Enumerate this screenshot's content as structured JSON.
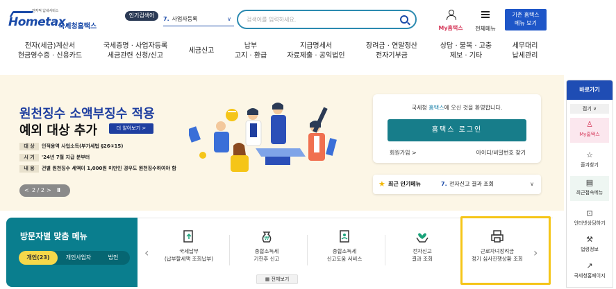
{
  "header": {
    "logo_tagline": "전자적 납세서비스",
    "logo_main": "Hometax.",
    "logo_sub": "국세청홈택스",
    "popular_badge": "인기검색어",
    "popular_item": {
      "num": "7.",
      "text": "사업자등록",
      "caret": "∨"
    },
    "search_placeholder": "검색어를 입력하세요.",
    "my_hometax": "My홈택스",
    "all_menu": "전체메뉴",
    "old_home": "기존 홈택스\n메뉴 보기"
  },
  "gnb": [
    {
      "line1": "전자(세금)계산서",
      "line2": "현금영수증 · 신용카드"
    },
    {
      "line1": "국세증명 · 사업자등록",
      "line2": "세금관련 신청/신고"
    },
    {
      "line1": "세금신고",
      "line2": ""
    },
    {
      "line1": "납부",
      "line2": "고지 · 환급"
    },
    {
      "line1": "지급명세서",
      "line2": "자료제출 · 공익법인"
    },
    {
      "line1": "장려금 · 연말정산",
      "line2": "전자기부금"
    },
    {
      "line1": "상담 · 불복 · 고충",
      "line2": "제보 · 기타"
    },
    {
      "line1": "세무대리",
      "line2": "납세관리"
    }
  ],
  "banner": {
    "title1": "원천징수 소액부징수 적용",
    "title2": "예외 대상 추가",
    "more": "더 알아보기 >",
    "rows": [
      {
        "key": "대 상",
        "value": "인적용역 사업소득(부가세법 §26①15)"
      },
      {
        "key": "시 기",
        "value": "'24년 7월 지급 분부터"
      },
      {
        "key": "내 용",
        "value": "건별 원천징수 세액이 1,000원 미만인 경우도 원천징수하여야 함"
      }
    ],
    "pager": {
      "prev": "<",
      "count": "2 / 2",
      "next": ">",
      "pause": "II"
    }
  },
  "login": {
    "welcome_pre": "국세청 ",
    "welcome_brand": "홈택스",
    "welcome_post": "에 오신 것을 환영합니다.",
    "login_button": "홈택스 로그인",
    "join": "회원가입 >",
    "find": "아이디/비밀번호 찾기"
  },
  "popular_menu": {
    "title": "최근 인기메뉴",
    "num": "7.",
    "text": "전자신고 결과 조회",
    "caret": "∨"
  },
  "visitor": {
    "title": "방문자별 맞춤 메뉴",
    "tabs": [
      "개인(23)",
      "개인사업자",
      "법인"
    ],
    "active_tab": 0
  },
  "services": {
    "prev": "‹",
    "next": "›",
    "items": [
      {
        "line1": "국세납부",
        "line2": "(납부할세액 조회납부)",
        "icon": "bill-upload-icon"
      },
      {
        "line1": "종합소득세",
        "line2": "기한후 신고",
        "icon": "money-bag-icon"
      },
      {
        "line1": "종합소득세",
        "line2": "신고도움 서비스",
        "icon": "document-person-icon"
      },
      {
        "line1": "전자신고",
        "line2": "결과 조회",
        "icon": "heart-hands-icon"
      },
      {
        "line1": "근로자녀장려금",
        "line2": "정기 심사진행상황 조회",
        "icon": "printer-icon"
      }
    ],
    "view_all": "전체보기"
  },
  "quick_menu": {
    "title": "바로가기",
    "fold": "접기 ∨",
    "items": [
      {
        "label": "My홈택스",
        "icon": "person-icon"
      },
      {
        "label": "즐겨찾기",
        "icon": "star-icon"
      },
      {
        "label": "최근접속메뉴",
        "icon": "recent-menu-icon"
      },
      {
        "label": "인터넷상담하기",
        "icon": "chat-monitor-icon"
      },
      {
        "label": "법령정보",
        "icon": "gavel-icon"
      },
      {
        "label": "국세청홈페이지",
        "icon": "external-link-icon"
      }
    ]
  },
  "colors": {
    "brand": "#1a4aa8",
    "teal": "#0a7e8e",
    "login": "#177d8a",
    "highlight": "#f5c518",
    "banner_bg": "#fcf6e6"
  }
}
